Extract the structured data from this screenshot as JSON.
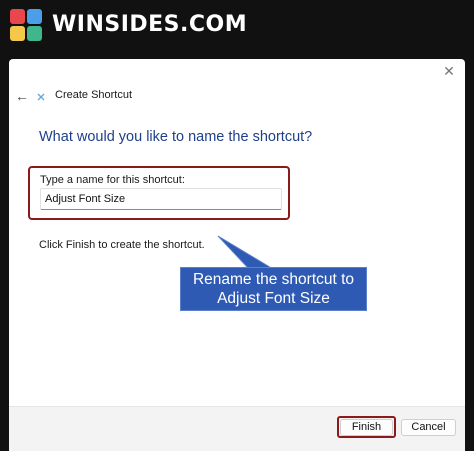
{
  "brand": {
    "name": "WINSIDES.COM",
    "logo_colors": [
      "#e8474c",
      "#4a9fe8",
      "#f5c84c",
      "#3fb68b"
    ]
  },
  "dialog": {
    "title": "Create Shortcut",
    "close_symbol": "✕",
    "back_symbol": "←",
    "heading": "What would you like to name the shortcut?",
    "field_label": "Type a name for this shortcut:",
    "field_value": "Adjust Font Size",
    "hint": "Click Finish to create the shortcut."
  },
  "callout": {
    "line1": "Rename the shortcut to",
    "line2": "Adjust Font Size",
    "color": "#2f5ab4"
  },
  "footer": {
    "finish_label": "Finish",
    "cancel_label": "Cancel"
  },
  "highlight_color": "#8b1a1a"
}
